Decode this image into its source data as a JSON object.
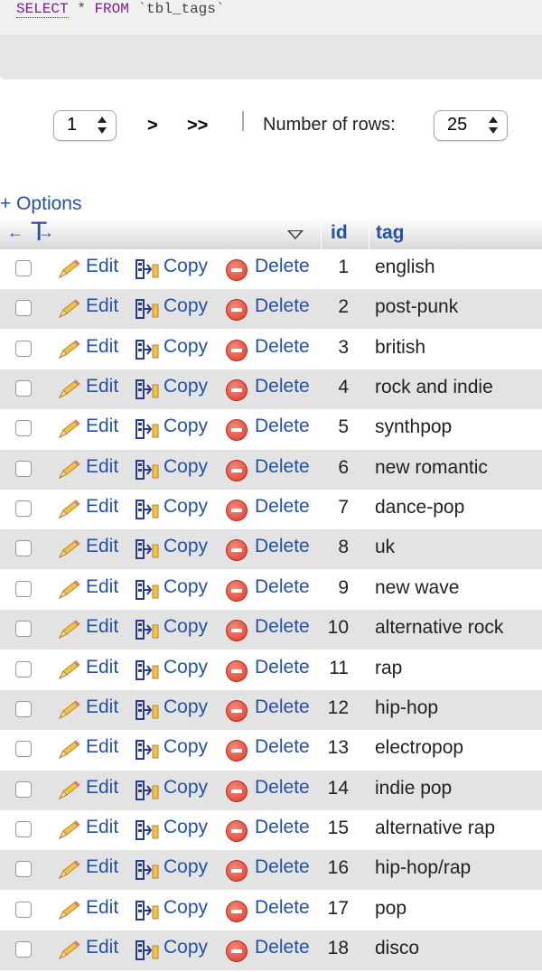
{
  "sql": {
    "kw_select": "SELECT",
    "star": "*",
    "kw_from": "FROM",
    "table": "`tbl_tags`"
  },
  "navigation": {
    "page_select": "1",
    "next": ">",
    "last": ">>",
    "rows_label": "Number of rows:",
    "rows_select": "25"
  },
  "options_link": "+ Options",
  "columns": {
    "id": "id",
    "tag": "tag"
  },
  "actions": {
    "edit": "Edit",
    "copy": "Copy",
    "delete": "Delete"
  },
  "rows": [
    {
      "id": "1",
      "tag": "english"
    },
    {
      "id": "2",
      "tag": "post-punk"
    },
    {
      "id": "3",
      "tag": "british"
    },
    {
      "id": "4",
      "tag": "rock and indie"
    },
    {
      "id": "5",
      "tag": "synthpop"
    },
    {
      "id": "6",
      "tag": "new romantic"
    },
    {
      "id": "7",
      "tag": "dance-pop"
    },
    {
      "id": "8",
      "tag": "uk"
    },
    {
      "id": "9",
      "tag": "new wave"
    },
    {
      "id": "10",
      "tag": "alternative rock"
    },
    {
      "id": "11",
      "tag": "rap"
    },
    {
      "id": "12",
      "tag": "hip-hop"
    },
    {
      "id": "13",
      "tag": "electropop"
    },
    {
      "id": "14",
      "tag": "indie pop"
    },
    {
      "id": "15",
      "tag": "alternative rap"
    },
    {
      "id": "16",
      "tag": "hip-hop/rap"
    },
    {
      "id": "17",
      "tag": "pop"
    },
    {
      "id": "18",
      "tag": "disco"
    }
  ],
  "colors": {
    "link": "#2451a8",
    "keyword": "#7a1d8f",
    "row_alt": "#e3e3e3"
  }
}
